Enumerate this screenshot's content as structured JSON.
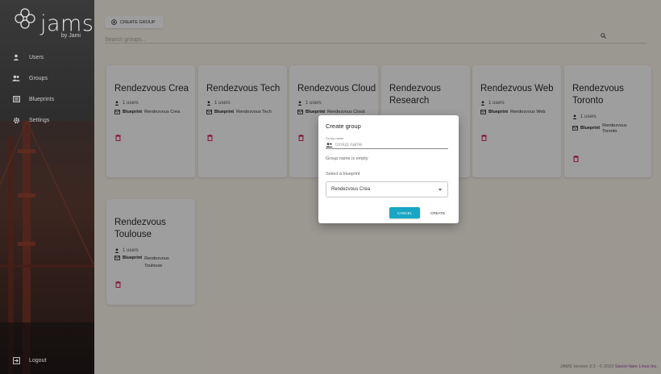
{
  "sidebar": {
    "logo_word": "jams",
    "logo_by": "by Jami",
    "items": [
      {
        "label": "Users",
        "icon": "user-icon"
      },
      {
        "label": "Groups",
        "icon": "groups-icon"
      },
      {
        "label": "Blueprints",
        "icon": "blueprint-icon"
      },
      {
        "label": "Settings",
        "icon": "gear-icon"
      }
    ],
    "logout_label": "Logout"
  },
  "toolbar": {
    "create_group_label": "CREATE GROUP",
    "search_placeholder": "Search groups..."
  },
  "cards": [
    {
      "title": "Rendezvous Crea",
      "users": "1 users",
      "blueprint_label": "Blueprint",
      "blueprint_name": "Rendezvous Crea"
    },
    {
      "title": "Rendezvous Tech",
      "users": "1 users",
      "blueprint_label": "Blueprint",
      "blueprint_name": "Rendezvous Tech"
    },
    {
      "title": "Rendezvous Cloud",
      "users": "1 users",
      "blueprint_label": "Blueprint",
      "blueprint_name": "Rendezvous Cloud"
    },
    {
      "title": "Rendezvous Research",
      "users": "",
      "blueprint_label": "",
      "blueprint_name": ""
    },
    {
      "title": "Rendezvous Web",
      "users": "1 users",
      "blueprint_label": "Blueprint",
      "blueprint_name": "Rendezvous Web"
    },
    {
      "title": "Rendezvous Toronto",
      "users": "1 users",
      "blueprint_label": "Blueprint",
      "blueprint_name": "Rendezvous Toronto"
    },
    {
      "title": "Rendezvous Toulouse",
      "users": "1 users",
      "blueprint_label": "Blueprint",
      "blueprint_name": "Rendezvous Toulouse"
    }
  ],
  "dialog": {
    "title": "Create group",
    "field_label": "Group name",
    "field_placeholder": "Group name",
    "error": "Group name is empty",
    "blueprint_label": "Select a blueprint",
    "blueprint_value": "Rendezvous Crea",
    "cancel_label": "CANCEL",
    "create_label": "CREATE"
  },
  "footer": {
    "text": "JAMS Version 3.3 - © 2023 ",
    "link": "Savoir-faire Linux Inc."
  },
  "colors": {
    "accent": "#17a6c4",
    "danger": "#d81b60",
    "footer_link": "#9b3fa5",
    "background": "#fbf5ea"
  }
}
